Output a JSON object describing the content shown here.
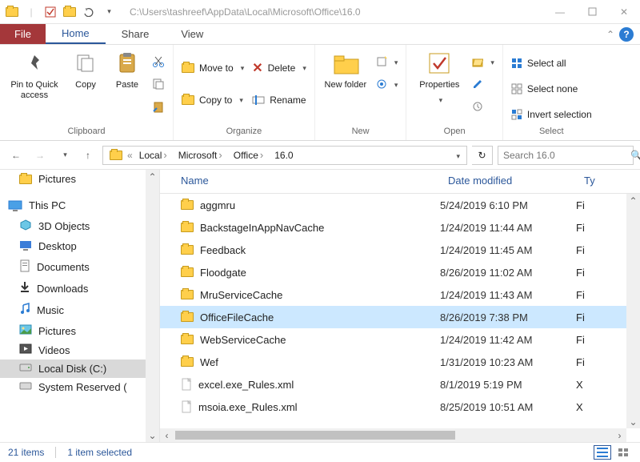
{
  "title": "C:\\Users\\tashreef\\AppData\\Local\\Microsoft\\Office\\16.0",
  "tabs": {
    "file": "File",
    "home": "Home",
    "share": "Share",
    "view": "View"
  },
  "ribbon": {
    "clipboard": {
      "label": "Clipboard",
      "pin": "Pin to Quick access",
      "copy": "Copy",
      "paste": "Paste"
    },
    "organize": {
      "label": "Organize",
      "move_to": "Move to",
      "copy_to": "Copy to",
      "delete": "Delete",
      "rename": "Rename"
    },
    "new": {
      "label": "New",
      "new_folder": "New folder"
    },
    "open": {
      "label": "Open",
      "properties": "Properties"
    },
    "select": {
      "label": "Select",
      "all": "Select all",
      "none": "Select none",
      "invert": "Invert selection"
    }
  },
  "breadcrumbs": [
    "Local",
    "Microsoft",
    "Office",
    "16.0"
  ],
  "search_placeholder": "Search 16.0",
  "nav_tree": {
    "pictures_qa": "Pictures",
    "this_pc": "This PC",
    "items": [
      "3D Objects",
      "Desktop",
      "Documents",
      "Downloads",
      "Music",
      "Pictures",
      "Videos",
      "Local Disk (C:)",
      "System Reserved ("
    ]
  },
  "columns": {
    "name": "Name",
    "date": "Date modified",
    "type": "Ty"
  },
  "files": [
    {
      "name": "aggmru",
      "date": "5/24/2019 6:10 PM",
      "type": "Fi",
      "kind": "folder"
    },
    {
      "name": "BackstageInAppNavCache",
      "date": "1/24/2019 11:44 AM",
      "type": "Fi",
      "kind": "folder"
    },
    {
      "name": "Feedback",
      "date": "1/24/2019 11:45 AM",
      "type": "Fi",
      "kind": "folder"
    },
    {
      "name": "Floodgate",
      "date": "8/26/2019 11:02 AM",
      "type": "Fi",
      "kind": "folder"
    },
    {
      "name": "MruServiceCache",
      "date": "1/24/2019 11:43 AM",
      "type": "Fi",
      "kind": "folder"
    },
    {
      "name": "OfficeFileCache",
      "date": "8/26/2019 7:38 PM",
      "type": "Fi",
      "kind": "folder",
      "selected": true
    },
    {
      "name": "WebServiceCache",
      "date": "1/24/2019 11:42 AM",
      "type": "Fi",
      "kind": "folder"
    },
    {
      "name": "Wef",
      "date": "1/31/2019 10:23 AM",
      "type": "Fi",
      "kind": "folder"
    },
    {
      "name": "excel.exe_Rules.xml",
      "date": "8/1/2019 5:19 PM",
      "type": "X",
      "kind": "file"
    },
    {
      "name": "msoia.exe_Rules.xml",
      "date": "8/25/2019 10:51 AM",
      "type": "X",
      "kind": "file"
    }
  ],
  "status": {
    "count": "21 items",
    "selected": "1 item selected"
  }
}
